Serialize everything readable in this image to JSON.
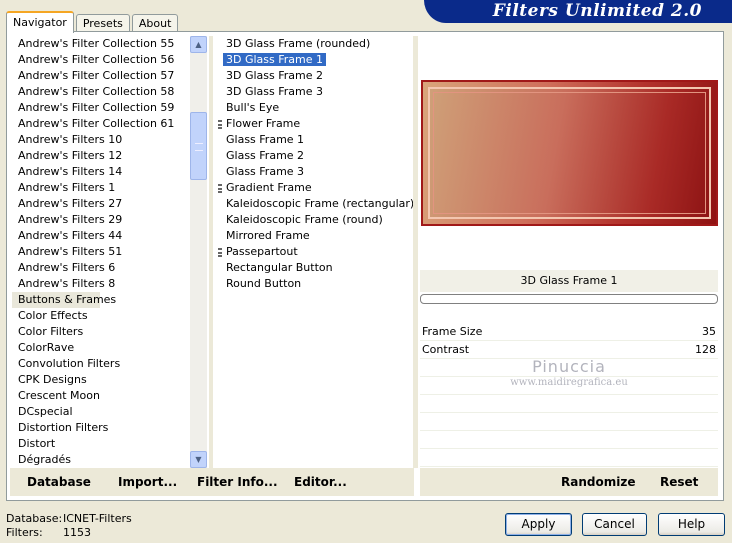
{
  "banner": {
    "title": "Filters Unlimited 2.0"
  },
  "tabs": {
    "navigator": "Navigator",
    "presets": "Presets",
    "about": "About"
  },
  "categories": [
    "Andrew's Filter Collection 55",
    "Andrew's Filter Collection 56",
    "Andrew's Filter Collection 57",
    "Andrew's Filter Collection 58",
    "Andrew's Filter Collection 59",
    "Andrew's Filter Collection 61",
    "Andrew's Filters 10",
    "Andrew's Filters 12",
    "Andrew's Filters 14",
    "Andrew's Filters 1",
    "Andrew's Filters 27",
    "Andrew's Filters 29",
    "Andrew's Filters 44",
    "Andrew's Filters 51",
    "Andrew's Filters 6",
    "Andrew's Filters 8",
    "Buttons & Frames",
    "Color Effects",
    "Color Filters",
    "ColorRave",
    "Convolution Filters",
    "CPK Designs",
    "Crescent Moon",
    "DCspecial",
    "Distortion Filters",
    "Distort",
    "Dégradés"
  ],
  "selected_category": "Buttons & Frames",
  "filters": [
    "3D Glass Frame (rounded)",
    "3D Glass Frame 1",
    "3D Glass Frame 2",
    "3D Glass Frame 3",
    "Bull's Eye",
    "Flower Frame",
    "Glass Frame 1",
    "Glass Frame 2",
    "Glass Frame 3",
    "Gradient Frame",
    "Kaleidoscopic Frame (rectangular)",
    "Kaleidoscopic Frame (round)",
    "Mirrored Frame",
    "Passepartout",
    "Rectangular Button",
    "Round Button"
  ],
  "selected_filter": "3D Glass Frame 1",
  "filter_name": "3D Glass Frame 1",
  "params": [
    {
      "name": "Frame Size",
      "value": "35"
    },
    {
      "name": "Contrast",
      "value": "128"
    }
  ],
  "watermark": {
    "line1": "Pinuccia",
    "line2": "www.maidiregrafica.eu"
  },
  "bottom": {
    "database": "Database",
    "import": "Import...",
    "filter_info": "Filter Info...",
    "editor": "Editor...",
    "randomize": "Randomize",
    "reset": "Reset"
  },
  "status": {
    "database_label": "Database:",
    "database_value": "ICNET-Filters",
    "filters_label": "Filters:",
    "filters_value": "1153"
  },
  "buttons": {
    "apply": "Apply",
    "cancel": "Cancel",
    "help": "Help"
  },
  "colors": {
    "banner": "#0a2a8a",
    "selection": "#316ac5",
    "frame_dark": "#8f1212",
    "frame_light": "#d9a57b"
  }
}
